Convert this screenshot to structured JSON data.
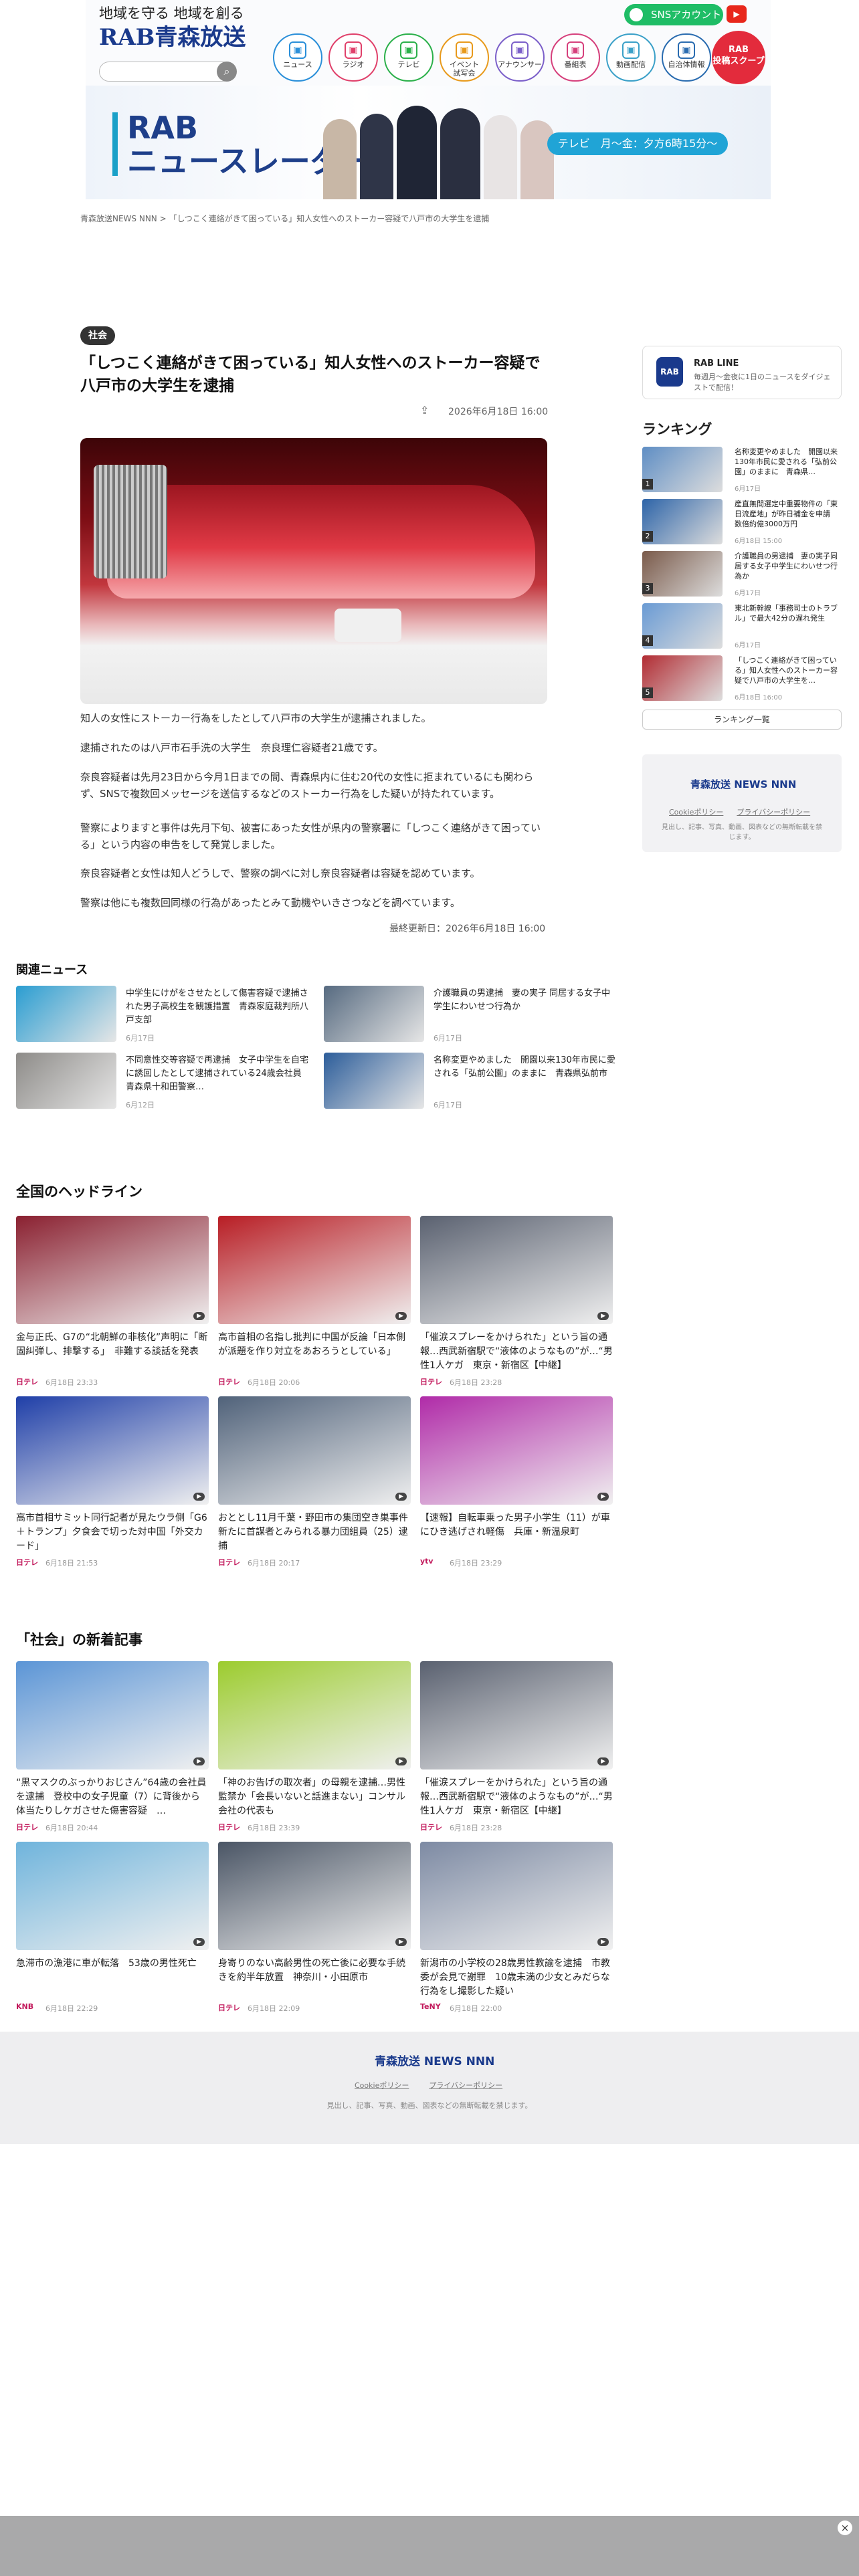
{
  "banner": {
    "tagline": "地域を守る 地域を創る",
    "logo": "RAB青森放送",
    "nav": [
      {
        "label": "ニュース",
        "icon": "newspaper-icon",
        "color": "#2a8fd9"
      },
      {
        "label": "ラジオ",
        "icon": "radio-icon",
        "color": "#e0406a"
      },
      {
        "label": "テレビ",
        "icon": "tv-icon",
        "color": "#2bb04a"
      },
      {
        "label": "イベント\n試写会",
        "icon": "ticket-icon",
        "color": "#e89a1c"
      },
      {
        "label": "アナウンサー",
        "icon": "people-icon",
        "color": "#7b5fc9"
      },
      {
        "label": "番組表",
        "icon": "list-icon",
        "color": "#d6407c"
      },
      {
        "label": "動画配信",
        "icon": "video-icon",
        "color": "#3aa0c8"
      },
      {
        "label": "自治体情報",
        "icon": "building-icon",
        "color": "#2a6cb0"
      }
    ],
    "sns_label": "SNSアカウント",
    "scoop": "RAB\n投稿スクープ",
    "program_title": "RAB\nニュースレーダー",
    "program_time": "テレビ　月〜金：夕方6時15分〜"
  },
  "breadcrumb": {
    "home": "青森放送NEWS NNN",
    "sep": ">",
    "current": "「しつこく連絡がきて困っている」知人女性へのストーカー容疑で八戸市の大学生を逮捕"
  },
  "article": {
    "category": "社会",
    "title": "「しつこく連絡がきて困っている」知人女性へのストーカー容疑で八戸市の大学生を逮捕",
    "date": "2026年6月18日 16:00",
    "paragraphs": [
      "知人の女性にストーカー行為をしたとして八戸市の大学生が逮捕されました。",
      "逮捕されたのは八戸市石手洗の大学生　奈良理仁容疑者21歳です。",
      "奈良容疑者は先月23日から今月1日までの間、青森県内に住む20代の女性に拒まれているにも関わらず、SNSで複数回メッセージを送信するなどのストーカー行為をした疑いが持たれています。",
      "警察によりますと事件は先月下旬、被害にあった女性が県内の警察署に「しつこく連絡がきて困っている」という内容の申告をして発覚しました。",
      "奈良容疑者と女性は知人どうしで、警察の調べに対し奈良容疑者は容疑を認めています。",
      "警察は他にも複数回同様の行為があったとみて動機やいきさつなどを調べています。"
    ],
    "updated": "最終更新日：2026年6月18日 16:00"
  },
  "related": {
    "heading": "関連ニュース",
    "items": [
      {
        "text": "中学生にけがをさせたとして傷害容疑で逮捕された男子高校生を観護措置　青森家庭裁判所八戸支部",
        "date": "6月17日"
      },
      {
        "text": "介護職員の男逮捕　妻の実子 同居する女子中学生にわいせつ行為か",
        "date": "6月17日"
      },
      {
        "text": "不同意性交等容疑で再逮捕　女子中学生を自宅に誘回したとして逮捕されている24歳会社員　青森県十和田警察…",
        "date": "6月12日"
      },
      {
        "text": "名称変更やめました　開園以来130年市民に愛される「弘前公園」のままに　青森県弘前市",
        "date": "6月17日"
      }
    ]
  },
  "national": {
    "heading": "全国のヘッドライン",
    "items": [
      {
        "text": "金与正氏、G7の“北朝鮮の非核化”声明に「断固糾弾し、排撃する」　非難する談話を発表",
        "src": "日テレ",
        "date": "6月18日 23:33"
      },
      {
        "text": "高市首相の名指し批判に中国が反論「日本側が派題を作り対立をあおろうとしている」",
        "src": "日テレ",
        "date": "6月18日 20:06"
      },
      {
        "text": "「催涙スプレーをかけられた」という旨の通報…西武新宿駅で“液体のようなもの”が…“男性1人ケガ　東京・新宿区【中継】",
        "src": "日テレ",
        "date": "6月18日 23:28"
      },
      {
        "text": "高市首相サミット同行記者が見たウラ側「G6＋トランプ」夕食会で切った対中国「外交カード」",
        "src": "日テレ",
        "date": "6月18日 21:53"
      },
      {
        "text": "おととし11月千葉・野田市の集団空き巣事件　新たに首謀者とみられる暴力団組員（25）逮捕",
        "src": "日テレ",
        "date": "6月18日 20:17"
      },
      {
        "text": "【速報】自転車乗った男子小学生（11）が車にひき逃げされ軽傷　兵庫・新温泉町",
        "src": "ytv",
        "date": "6月18日 23:29"
      }
    ]
  },
  "society": {
    "heading": "「社会」の新着記事",
    "items": [
      {
        "text": "“黒マスクのぶっかりおじさん”64歳の会社員を逮捕　登校中の女子児童（7）に背後から体当たりしケガさせた傷害容疑　…",
        "src": "日テレ",
        "date": "6月18日 20:44"
      },
      {
        "text": "「神のお告げの取次者」の母親を逮捕…男性監禁か「会長いないと話進まない」コンサル会社の代表も",
        "src": "日テレ",
        "date": "6月18日 23:39"
      },
      {
        "text": "「催涙スプレーをかけられた」という旨の通報…西武新宿駅で“液体のようなもの”が…“男性1人ケガ　東京・新宿区【中継】",
        "src": "日テレ",
        "date": "6月18日 23:28"
      },
      {
        "text": "急滞市の漁港に車が転落　53歳の男性死亡",
        "src": "KNB",
        "date": "6月18日 22:29"
      },
      {
        "text": "身寄りのない高齢男性の死亡後に必要な手続きを約半年放置　神奈川・小田原市",
        "src": "日テレ",
        "date": "6月18日 22:09"
      },
      {
        "text": "新潟市の小学校の28歳男性教諭を逮捕　市教委が会見で謝罪　10歳未満の少女とみだらな行為をし撮影した疑い",
        "src": "TeNY",
        "date": "6月18日 22:00"
      }
    ]
  },
  "sidebar": {
    "line_title": "RAB LINE",
    "line_desc": "毎週月〜金夜に1日のニュースをダイジェストで配信！",
    "line_logo": "RAB",
    "ranking_heading": "ランキング",
    "ranking": [
      {
        "num": "1",
        "text": "名称変更やめました　開園以来130年市民に愛される「弘前公園」のままに　青森県…",
        "date": "6月17日"
      },
      {
        "num": "2",
        "text": "産直無間選定中重要物件の「東日流産地」が昨日補金を申請　数倍約億3000万円",
        "date": "6月18日 15:00"
      },
      {
        "num": "3",
        "text": "介護職員の男逮捕　妻の実子同居する女子中学生にわいせつ行為か",
        "date": "6月17日"
      },
      {
        "num": "4",
        "text": "東北新幹線「事務司士のトラブル」で最大42分の遅れ発生",
        "date": "6月17日"
      },
      {
        "num": "5",
        "text": "「しつこく連絡がきて困っている」知人女性へのストーカー容疑で八戸市の大学生を…",
        "date": "6月18日 16:00"
      }
    ],
    "ranking_more": "ランキング一覧",
    "footer_logo": "青森放送 NEWS NNN",
    "cookie": "Cookieポリシー",
    "privacy": "プライバシーポリシー",
    "note": "見出し、記事、写真、動画、図表などの無断転載を禁じます。"
  },
  "footer": {
    "logo": "青森放送 NEWS NNN",
    "cookie": "Cookieポリシー",
    "privacy": "プライバシーポリシー",
    "note": "見出し、記事、写真、動画、図表などの無断転載を禁じます。"
  },
  "ad": {
    "close": "×"
  }
}
